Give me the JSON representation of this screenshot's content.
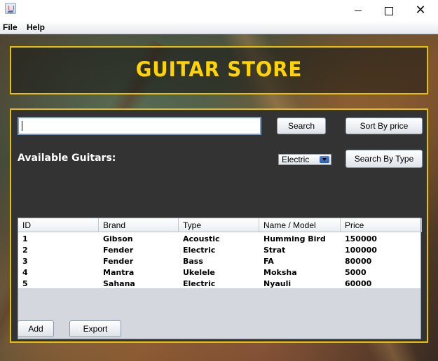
{
  "window": {
    "close_glyph": "✕"
  },
  "menu": {
    "file": "File",
    "help": "Help"
  },
  "banner": {
    "title": "GUITAR STORE"
  },
  "search": {
    "value": "",
    "search_button": "Search",
    "sort_button": "Sort By price"
  },
  "filter": {
    "section_label": "Available Guitars:",
    "selected_type": "Electric",
    "search_by_type_button": "Search By Type"
  },
  "table": {
    "headers": [
      "ID",
      "Brand",
      "Type",
      "Name / Model",
      "Price"
    ],
    "rows": [
      [
        "1",
        "Gibson",
        "Acoustic",
        "Humming Bird",
        "150000"
      ],
      [
        "2",
        "Fender",
        "Electric",
        "Strat",
        "100000"
      ],
      [
        "3",
        "Fender",
        "Bass",
        "FA",
        "80000"
      ],
      [
        "4",
        "Mantra",
        "Ukelele",
        "Moksha",
        "5000"
      ],
      [
        "5",
        "Sahana",
        "Electric",
        "Nyauli",
        "60000"
      ]
    ]
  },
  "actions": {
    "add": "Add",
    "export": "Export"
  },
  "icons": {
    "app_icon": "java-icon",
    "dropdown_arrow": "chevron-down-icon"
  },
  "colors": {
    "accent_yellow": "#ffd400",
    "panel_bg": "#333333",
    "border_yellow": "#e8c100"
  }
}
